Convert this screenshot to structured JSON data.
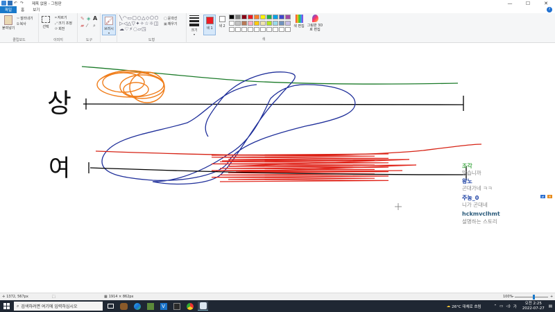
{
  "window": {
    "title": "제목 없음 - 그림판",
    "controls": [
      "—",
      "☐",
      "✕"
    ]
  },
  "tabs": [
    "파일",
    "홈",
    "보기"
  ],
  "ribbon": {
    "clipboard": {
      "paste": "붙여넣기",
      "cut": "잘라내기",
      "copy": "복사",
      "label": "클립보드"
    },
    "image": {
      "select": "선택",
      "crop": "자르기",
      "resize": "크기 조정",
      "rotate": "회전",
      "label": "이미지"
    },
    "tools": {
      "label": "도구"
    },
    "brushes": {
      "label": "브러시"
    },
    "shapes": {
      "outline": "윤곽선",
      "fill": "채우기",
      "label": "도형"
    },
    "size": {
      "label": "크기"
    },
    "color1": "색 1",
    "color2": "색 2",
    "edit_colors": "색 편집",
    "paint3d": "그림판 3D로 편집",
    "colors_label": "색",
    "palette": [
      "#000000",
      "#7f7f7f",
      "#880015",
      "#ed1c24",
      "#ff7f27",
      "#fff200",
      "#22b14c",
      "#00a2e8",
      "#3f48cc",
      "#a349a4",
      "#ffffff",
      "#c3c3c3",
      "#b97a57",
      "#ffaec9",
      "#ffc90e",
      "#efe4b0",
      "#b5e61d",
      "#99d9ea",
      "#7092be",
      "#c8bfe7"
    ],
    "active_color1": "#ed1c24"
  },
  "canvas": {
    "handwriting": [
      "상",
      "여"
    ]
  },
  "chat": [
    {
      "name": "조각",
      "name_color": "#4caf50",
      "message": "맞습니까"
    },
    {
      "name": "왕노",
      "name_color": "#1a3fa3",
      "message": "곤대가네 ㅋㅋ"
    },
    {
      "name": "주농_0",
      "name_color": "#1a3fa3",
      "message": "니가 곤대네"
    },
    {
      "name": "hckmvclhmt",
      "name_color": "#2a5a7a",
      "message": "설명하는 스토리"
    }
  ],
  "status": {
    "cursor": "1372, 567px",
    "selection": "",
    "canvas_size": "1914 × 862px",
    "zoom": "100%"
  },
  "taskbar": {
    "search_placeholder": "검색하려면 여기에 입력하십시오",
    "weather": "26°C 대체로 흐림",
    "time": "오전 2:25",
    "date": "2022-07-27"
  }
}
